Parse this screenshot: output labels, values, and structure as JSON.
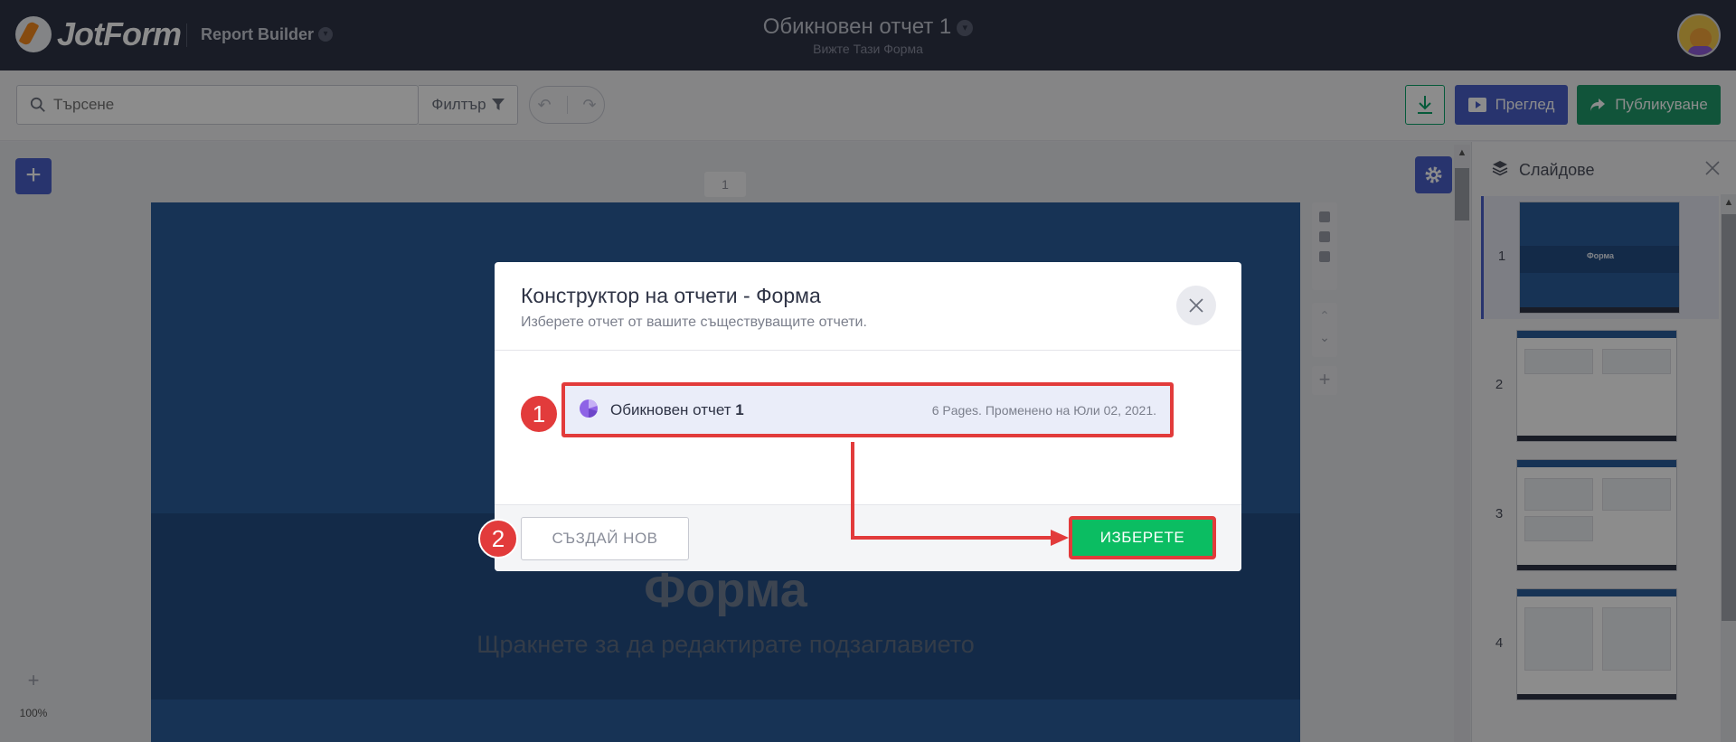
{
  "brand": {
    "name": "JotForm",
    "product": "Report Builder"
  },
  "header": {
    "title": "Обикновен отчет 1",
    "subtitle": "Вижте Тази Форма"
  },
  "toolbar": {
    "search_placeholder": "Търсене",
    "filter_label": "Филтър",
    "preview_label": "Преглед",
    "publish_label": "Публикуване"
  },
  "canvas": {
    "page_number": "1",
    "slide_title": "Форма",
    "slide_subtitle": "Щракнете за да редактирате подзаглавието",
    "zoom": "100%"
  },
  "slides_panel": {
    "title": "Слайдове",
    "items": [
      {
        "number": "1",
        "thumb_title": "Форма",
        "active": true
      },
      {
        "number": "2",
        "active": false
      },
      {
        "number": "3",
        "active": false
      },
      {
        "number": "4",
        "active": false
      }
    ]
  },
  "modal": {
    "title": "Конструктор на отчети - Форма",
    "subtitle": "Изберете отчет от вашите съществуващите отчети.",
    "report": {
      "name": "Обикновен отчет",
      "name_number": "1",
      "meta": "6 Pages. Променено на Юли 02, 2021."
    },
    "create_label": "СЪЗДАЙ НОВ",
    "select_label": "ИЗБЕРЕТЕ"
  },
  "annotations": {
    "step1": "1",
    "step2": "2"
  },
  "colors": {
    "topbar": "#2f3446",
    "accent_blue": "#4a60c8",
    "publish_green": "#1f9a6a",
    "select_green": "#0bbd62",
    "annotation_red": "#e23b3b",
    "slide_blue": "#2a5d9b"
  }
}
